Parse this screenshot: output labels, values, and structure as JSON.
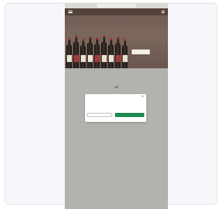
{
  "browser": {
    "time": "",
    "url": "",
    "status_icons": ""
  },
  "hero": {
    "site_name": "",
    "title": "",
    "subtitle": "",
    "cta_label": ""
  },
  "content": {
    "line1": "",
    "line2": ""
  },
  "cookie_modal": {
    "title": "",
    "close_glyph": "×",
    "body": "",
    "link": "",
    "decline_label": "",
    "accept_label": "",
    "manage_label": ""
  },
  "colors": {
    "accept_button": "#1d8a52",
    "overlay": "#b3b2af",
    "hero": "#6e5a50"
  }
}
